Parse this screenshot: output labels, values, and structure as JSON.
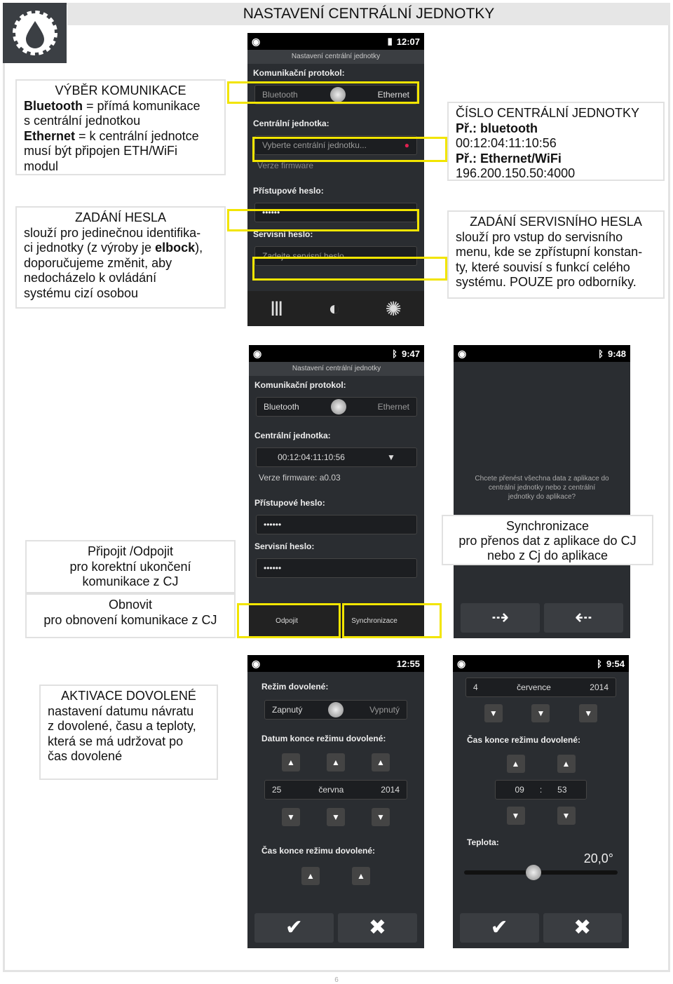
{
  "header": {
    "title": "NASTAVENÍ CENTRÁLNÍ JEDNOTKY",
    "logo_icon": "gear-drop-icon"
  },
  "notes": {
    "comm": {
      "title": "VÝBĚR KOMUNIKACE",
      "l1b": "Bluetooth",
      "l1": " = přímá komunikace",
      "l2": "s centrální jednotkou",
      "l3b": "Ethernet",
      "l3": " = k centrální jednotce",
      "l4": "musí být připojen ETH/WiFi",
      "l5": "modul"
    },
    "unit": {
      "title": "ČÍSLO CENTRÁLNÍ JEDNOTKY",
      "l1b": "Př.: bluetooth",
      "l2": "00:12:04:11:10:56",
      "l3b": "Př.: Ethernet/WiFi",
      "l4": "196.200.150.50:4000"
    },
    "pass": {
      "title": "ZADÁNÍ HESLA",
      "l1": "slouží pro jedinečnou identifika-",
      "l2a": "ci jednotky (z výroby je ",
      "l2b": "elbock",
      "l2c": "),",
      "l3": "doporučujeme změnit, aby",
      "l4": "nedocházelo k ovládání",
      "l5": "systému cizí osobou"
    },
    "service": {
      "title": "ZADÁNÍ SERVISNÍHO HESLA",
      "l1": "slouží pro vstup do servisního",
      "l2": "menu, kde se zpřístupní konstan-",
      "l3": "ty, které souvisí s funkcí celého",
      "l4": "systému. POUZE pro odborníky."
    },
    "connect": {
      "l1": "Připojit /Odpojit",
      "l2": "pro korektní ukončení",
      "l3": "komunikace z CJ"
    },
    "refresh": {
      "l1": "Obnovit",
      "l2": "pro obnovení komunikace z CJ"
    },
    "sync": {
      "l1": "Synchronizace",
      "l2": "pro přenos dat z aplikace do CJ",
      "l3": "nebo z Cj do aplikace"
    },
    "vacation": {
      "title": "AKTIVACE DOVOLENÉ",
      "l1": "nastavení datumu návratu",
      "l2": "z dovolené, času a teploty,",
      "l3": "která se má udržovat po",
      "l4": "čas dovolené"
    }
  },
  "phone1": {
    "time": "12:07",
    "title": "Nastavení centrální jednotky",
    "protocol_label": "Komunikační protokol:",
    "opt1": "Bluetooth",
    "opt2": "Ethernet",
    "unit_label": "Centrální jednotka:",
    "unit_placeholder": "Vyberte centrální jednotku...",
    "firmware": "Verze firmware",
    "pass_label": "Přístupové heslo:",
    "pass_value": "••••••",
    "service_label": "Servisní heslo:",
    "service_placeholder": "Zadejte servisní heslo..."
  },
  "phone2": {
    "time": "9:47",
    "title": "Nastavení centrální jednotky",
    "protocol_label": "Komunikační protokol:",
    "opt1": "Bluetooth",
    "opt2": "Ethernet",
    "unit_label": "Centrální jednotka:",
    "unit_value": "00:12:04:11:10:56",
    "firmware": "Verze firmware: a0.03",
    "pass_label": "Přístupové heslo:",
    "pass_value": "••••••",
    "service_label": "Servisní heslo:",
    "service_value": "••••••",
    "disconnect": "Odpojit",
    "sync": "Synchronizace"
  },
  "phone3": {
    "time": "9:48",
    "question": "Chcete přenést všechna data z aplikace do centrální jednotky nebo z centrální jednotky do aplikace?"
  },
  "phone4": {
    "time": "12:55",
    "mode_label": "Režim dovolené:",
    "opt1": "Zapnutý",
    "opt2": "Vypnutý",
    "date_label": "Datum konce režimu dovolené:",
    "day": "25",
    "month": "června",
    "year": "2014",
    "time_label": "Čas konce režimu dovolené:"
  },
  "phone5": {
    "time": "9:54",
    "day": "4",
    "month": "července",
    "year": "2014",
    "time_label": "Čas konce režimu dovolené:",
    "hour": "09",
    "sep": ":",
    "minute": "53",
    "temp_label": "Teplota:",
    "temp_value": "20,0°",
    "temp_fraction": 0.4
  },
  "footer": {
    "page": "6"
  }
}
